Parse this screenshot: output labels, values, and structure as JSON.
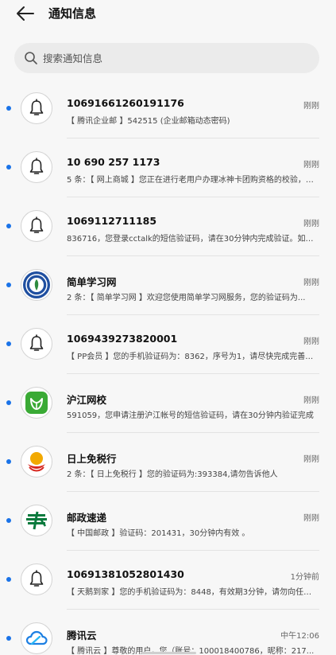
{
  "header": {
    "title": "通知信息"
  },
  "search": {
    "placeholder": "搜索通知信息"
  },
  "messages": [
    {
      "name": "10691661260191176",
      "time": "刚刚",
      "preview": "【 腾讯企业邮 】542515 (企业邮箱动态密码)",
      "icon": "bell-icon"
    },
    {
      "name": "10 690 257 1173",
      "time": "刚刚",
      "preview": "5 条：【 网上商城 】您正在进行老用户办理冰神卡团购资格的校验，验证码为...",
      "icon": "bell-icon"
    },
    {
      "name": "1069112711185",
      "time": "刚刚",
      "preview": "836716，您登录cctalk的短信验证码，请在30分钟内完成验证。如非本人操作请忽略",
      "icon": "bell-icon"
    },
    {
      "name": "简单学习网",
      "time": "刚刚",
      "preview": "2 条：【 简单学习网 】欢迎您使用简单学习网服务，您的验证码为...",
      "icon": "jiandan-logo-icon"
    },
    {
      "name": "1069439273820001",
      "time": "刚刚",
      "preview": "【 PP会员 】您的手机验证码为：8362，序号为1，请尽快完成完善资料",
      "icon": "bell-icon"
    },
    {
      "name": "沪江网校",
      "time": "刚刚",
      "preview": "591059，您申请注册沪江帐号的短信验证码，请在30分钟内验证完成",
      "icon": "hujiang-logo-icon"
    },
    {
      "name": "日上免税行",
      "time": "刚刚",
      "preview": "2 条：【 日上免税行 】您的验证码为:393384,请勿告诉他人",
      "icon": "rishang-logo-icon"
    },
    {
      "name": "邮政速递",
      "time": "刚刚",
      "preview": "【 中国邮政 】验证码：201431，30分钟内有效 。",
      "icon": "china-post-logo-icon"
    },
    {
      "name": "10691381052801430",
      "time": "1分钟前",
      "preview": "【 天鹅到家 】您的手机验证码为：8448，有效期3分钟，请勿向任何人透露",
      "icon": "bell-icon"
    },
    {
      "name": "腾讯云",
      "time": "中午12:06",
      "preview": "【 腾讯云 】尊敬的用户，您（账号：100018400786，昵称：217...",
      "icon": "tencent-cloud-logo-icon"
    }
  ],
  "colors": {
    "unread_dot": "#1a73e8",
    "background": "#f7f7f7"
  }
}
